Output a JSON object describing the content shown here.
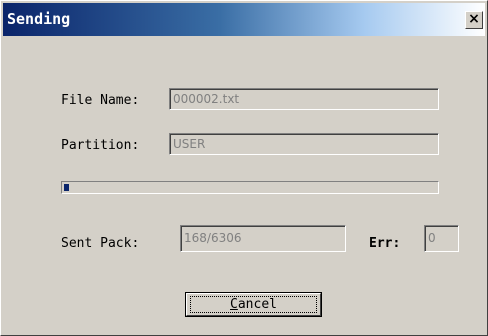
{
  "window": {
    "title": "Sending",
    "close_label": "×"
  },
  "fields": {
    "file_name": {
      "label": "File Name:",
      "value": "000002.txt"
    },
    "partition": {
      "label": "Partition:",
      "value": "USER"
    },
    "sent_pack": {
      "label": "Sent Pack:",
      "value": "168/6306"
    },
    "err": {
      "label": "Err:",
      "value": "0"
    }
  },
  "progress": {
    "fraction": 0.0266
  },
  "buttons": {
    "cancel": {
      "mnemonic": "C",
      "rest": "ancel"
    }
  },
  "colors": {
    "face": "#d4d0c8",
    "title_start": "#0a246a",
    "progress_fill": "#0a246a",
    "disabled_text": "#808080"
  }
}
